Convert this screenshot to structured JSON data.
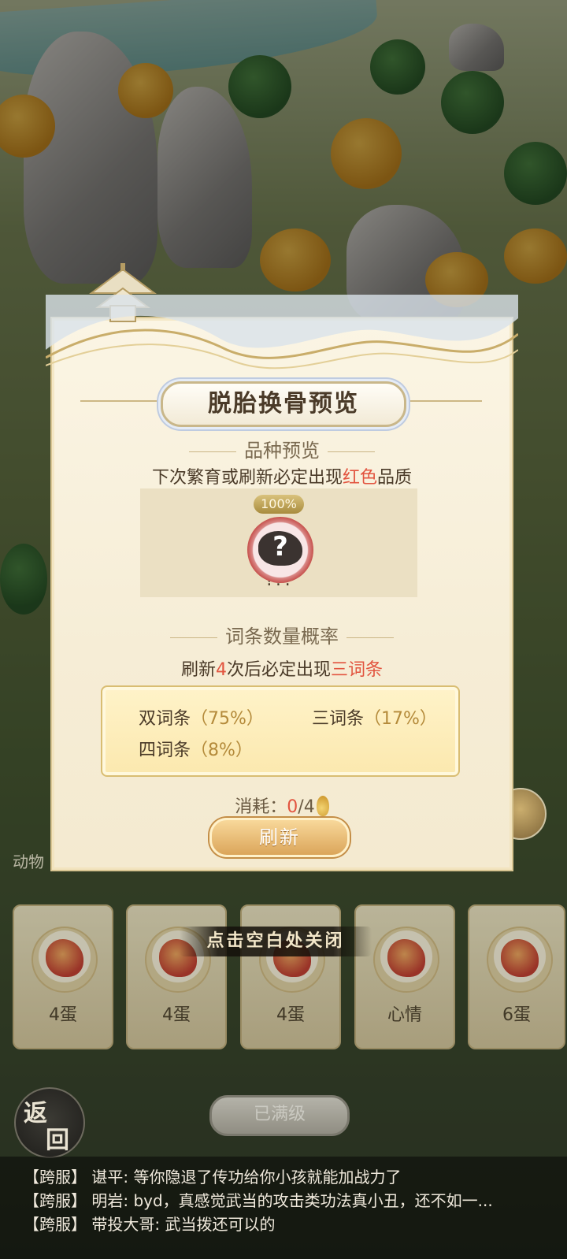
{
  "modal": {
    "title": "脱胎换骨预览",
    "breed_section": "品种预览",
    "breed_note_prefix": "下次繁育或刷新必定出现",
    "breed_note_highlight": "红色",
    "breed_note_suffix": "品质",
    "preview_percent": "100%",
    "preview_name": "???",
    "trait_section": "词条数量概率",
    "trait_note_prefix": "刷新",
    "trait_note_count": "4",
    "trait_note_middle": "次后必定出现",
    "trait_note_highlight": "三词条",
    "probabilities": [
      {
        "label": "双词条",
        "percent": "（75%）"
      },
      {
        "label": "三词条",
        "percent": "（17%）"
      },
      {
        "label": "四词条",
        "percent": "（8%）"
      }
    ],
    "cost_label": "消耗：",
    "cost_current": "0",
    "cost_total": "/4",
    "refresh_label": "刷新"
  },
  "background": {
    "animals_label": "动物",
    "close_tip": "点击空白处关闭",
    "cards": [
      {
        "label": "4蛋"
      },
      {
        "label": "4蛋"
      },
      {
        "label": "4蛋"
      },
      {
        "label": "心情"
      },
      {
        "label": "6蛋"
      }
    ],
    "max_level_label": "已满级",
    "back_label_1": "返",
    "back_label_2": "回"
  },
  "chat": {
    "lines": [
      {
        "tag": "【跨服】",
        "text": "谌平: 等你隐退了传功给你小孩就能加战力了"
      },
      {
        "tag": "【跨服】",
        "text": "明岩: byd，真感觉武当的攻击类功法真小丑，还不如一..."
      },
      {
        "tag": "【跨服】",
        "text": "带投大哥: 武当拨还可以的"
      }
    ]
  },
  "colors": {
    "highlight_red": "#e2543f",
    "panel_bg": "#fbf5e4",
    "button_gold": "#dba55a"
  }
}
